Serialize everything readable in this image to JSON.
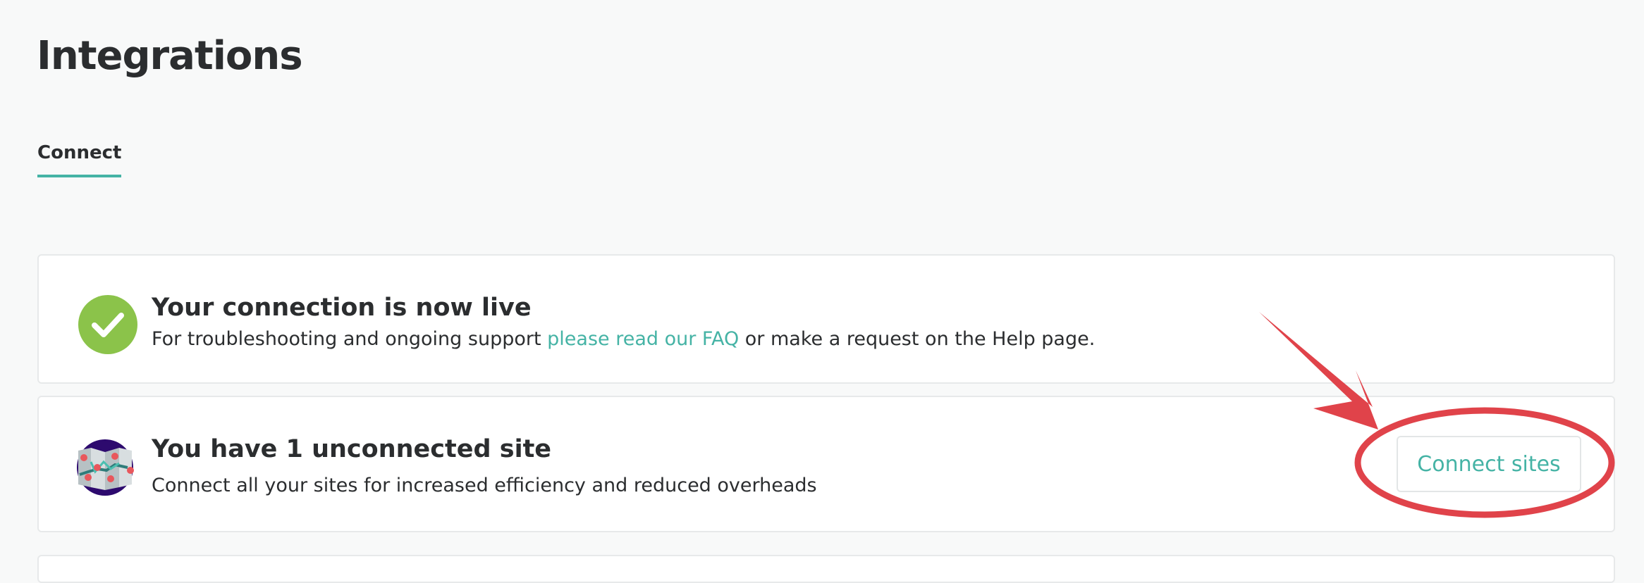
{
  "page": {
    "title": "Integrations"
  },
  "tabs": [
    {
      "label": "Connect",
      "active": true
    }
  ],
  "connection_card": {
    "title": "Your connection is now live",
    "desc_before": "For troubleshooting and ongoing support ",
    "link_text": "please read our FAQ",
    "desc_after": " or make a request on the Help page.",
    "icon": "check-circle-icon"
  },
  "sites_card": {
    "title": "You have 1 unconnected site",
    "desc": "Connect all your sites for increased efficiency and reduced overheads",
    "button_label": "Connect sites",
    "icon": "map-icon"
  },
  "annotation": {
    "arrow_color": "#e0434a",
    "circle_color": "#e0434a"
  },
  "colors": {
    "accent": "#45b3a5",
    "success": "#8bc34a",
    "background": "#f8f9f9",
    "text": "#2b2d2f"
  }
}
